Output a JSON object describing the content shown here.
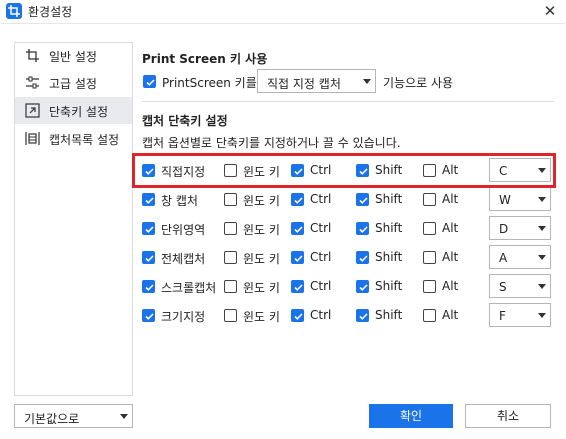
{
  "window": {
    "title": "환경설정",
    "close_glyph": "✕",
    "app_icon": "crop-icon"
  },
  "sidebar": {
    "items": [
      {
        "label": "일반 설정",
        "icon": "crop-icon",
        "active": false
      },
      {
        "label": "고급 설정",
        "icon": "sliders-icon",
        "active": false
      },
      {
        "label": "단축키 설정",
        "icon": "shortcut-icon",
        "active": true
      },
      {
        "label": "캡처목록 설정",
        "icon": "capture-list-icon",
        "active": false
      }
    ]
  },
  "print_screen": {
    "section_title": "Print Screen 키 사용",
    "checkbox_label": "PrintScreen 키를",
    "checked": true,
    "select_value": "직접 지정 캡처",
    "suffix": "기능으로 사용"
  },
  "shortcut": {
    "section_title": "캡처 단축키 설정",
    "description": "캡처 옵션별로 단축키를 지정하거나 끌 수 있습니다.",
    "modifier_labels": {
      "win": "윈도 키",
      "ctrl": "Ctrl",
      "shift": "Shift",
      "alt": "Alt"
    },
    "rows": [
      {
        "name": "직접지정",
        "enabled": true,
        "win": false,
        "ctrl": true,
        "shift": true,
        "alt": false,
        "key": "C",
        "highlighted": true
      },
      {
        "name": "창 캡처",
        "enabled": true,
        "win": false,
        "ctrl": true,
        "shift": true,
        "alt": false,
        "key": "W",
        "highlighted": false
      },
      {
        "name": "단위영역",
        "enabled": true,
        "win": false,
        "ctrl": true,
        "shift": true,
        "alt": false,
        "key": "D",
        "highlighted": false
      },
      {
        "name": "전체캡처",
        "enabled": true,
        "win": false,
        "ctrl": true,
        "shift": true,
        "alt": false,
        "key": "A",
        "highlighted": false
      },
      {
        "name": "스크롤캡처",
        "enabled": true,
        "win": false,
        "ctrl": true,
        "shift": true,
        "alt": false,
        "key": "S",
        "highlighted": false
      },
      {
        "name": "크기지정",
        "enabled": true,
        "win": false,
        "ctrl": true,
        "shift": true,
        "alt": false,
        "key": "F",
        "highlighted": false
      }
    ]
  },
  "footer": {
    "defaults_select": "기본값으로",
    "ok_label": "확인",
    "cancel_label": "취소"
  },
  "colors": {
    "accent": "#1a73e8",
    "highlight": "#e0242b",
    "active_item": "#e8eaed"
  }
}
